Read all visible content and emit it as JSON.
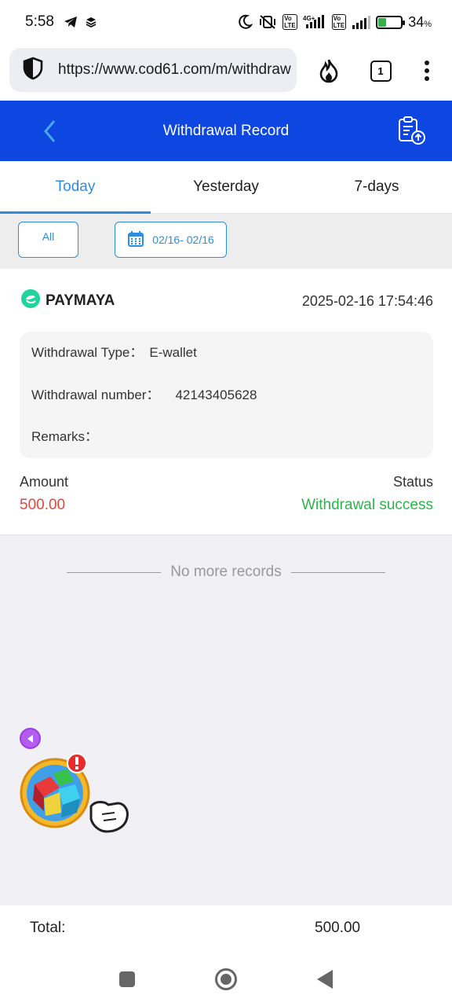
{
  "status_bar": {
    "time": "5:58",
    "battery_percent": "34",
    "battery_unit": "%",
    "battery_level": 0.34
  },
  "browser": {
    "url": "https://www.cod61.com/m/withdraw",
    "tab_count": "1"
  },
  "header": {
    "title": "Withdrawal Record"
  },
  "tabs": [
    {
      "label": "Today",
      "active": true
    },
    {
      "label": "Yesterday",
      "active": false
    },
    {
      "label": "7-days",
      "active": false
    }
  ],
  "filters": {
    "type_label": "All",
    "date_range": "02/16- 02/16"
  },
  "record": {
    "provider": "PAYMAYA",
    "datetime": "2025-02-16 17:54:46",
    "type_label": "Withdrawal Type：",
    "type_value": "E-wallet",
    "number_label": "Withdrawal number：",
    "number_value": "42143405628",
    "remarks_label": "Remarks：",
    "amount_label": "Amount",
    "amount_value": "500.00",
    "status_label": "Status",
    "status_value": "Withdrawal success"
  },
  "no_more_text": "No more records",
  "total": {
    "label": "Total:",
    "value": "500.00"
  },
  "colors": {
    "header_bg": "#0d46e0",
    "accent": "#2d8de0",
    "amount": "#e0473a",
    "success": "#2fb34c",
    "paymaya": "#20d4a0"
  }
}
